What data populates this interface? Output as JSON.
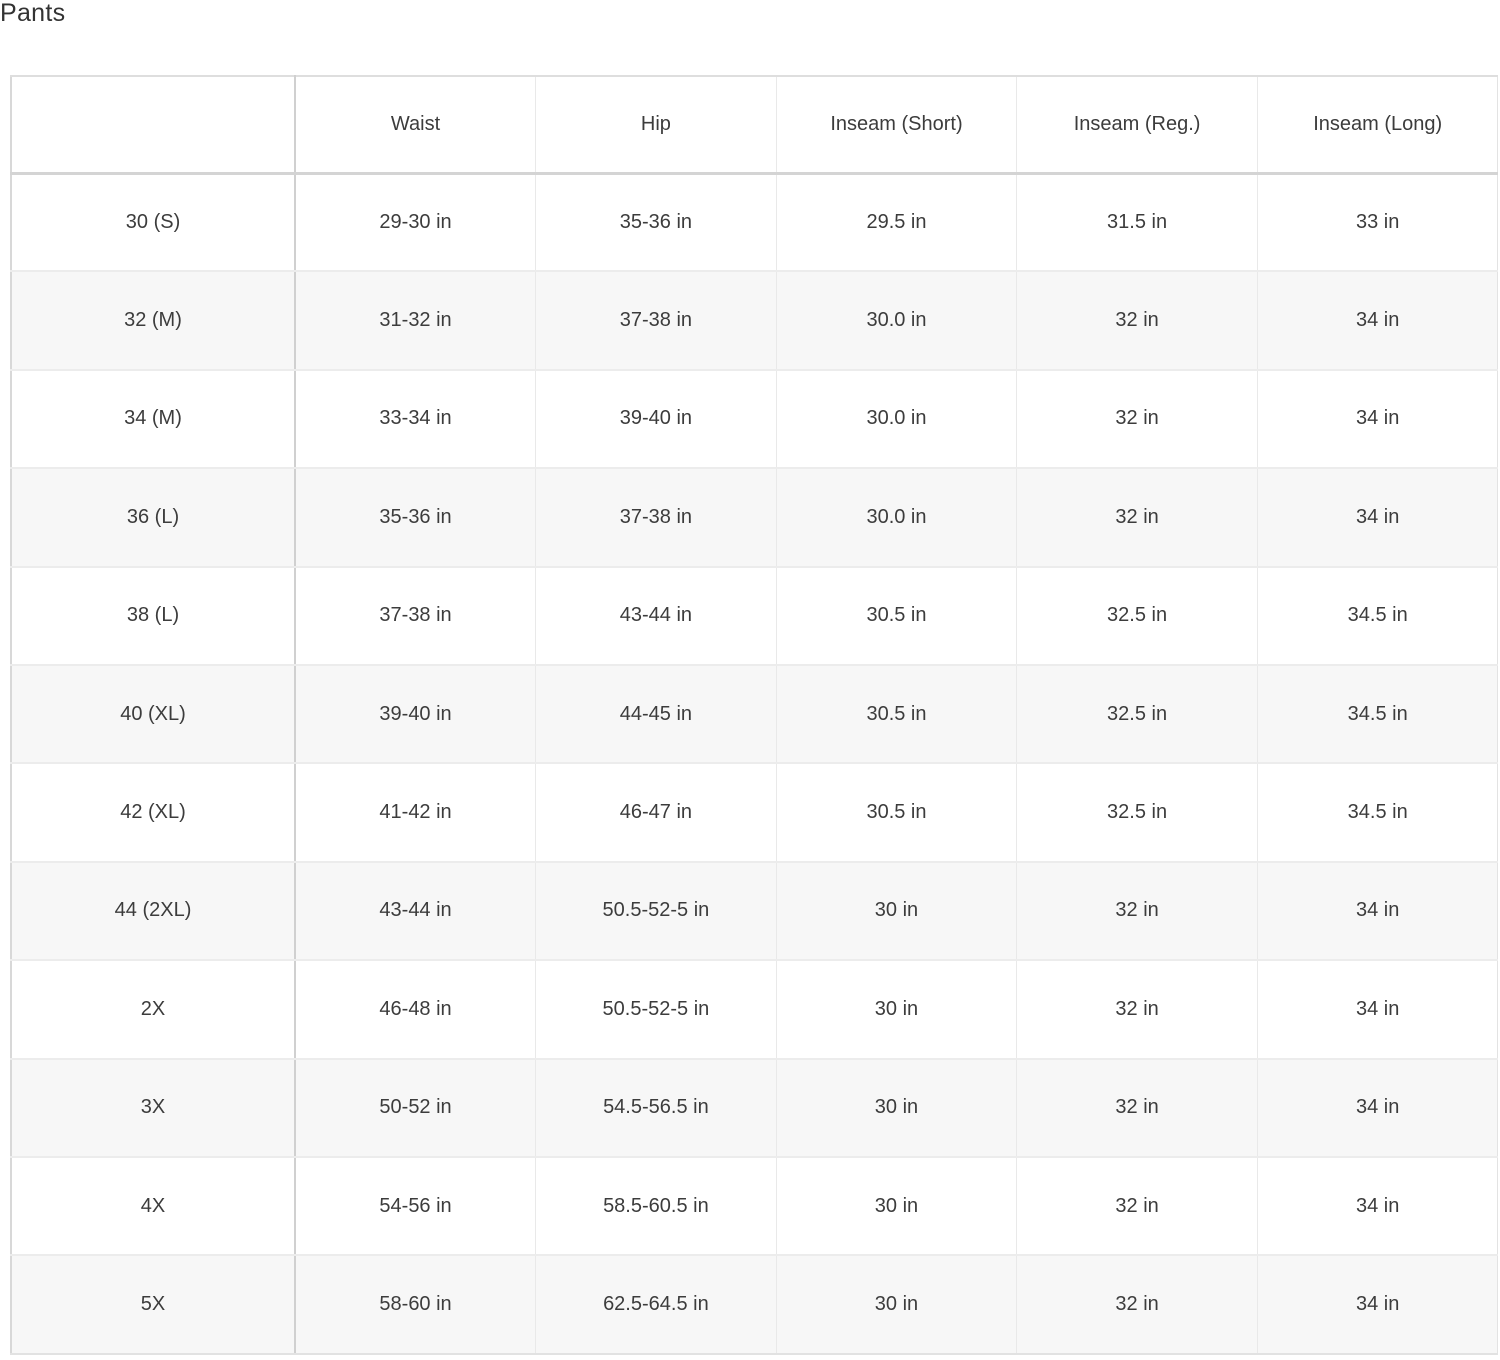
{
  "title": "Pants",
  "table": {
    "headers": [
      "",
      "Waist",
      "Hip",
      "Inseam (Short)",
      "Inseam (Reg.)",
      "Inseam (Long)"
    ],
    "rows": [
      [
        "30 (S)",
        "29-30 in",
        "35-36 in",
        "29.5 in",
        "31.5 in",
        "33 in"
      ],
      [
        "32 (M)",
        "31-32 in",
        "37-38 in",
        "30.0 in",
        "32 in",
        "34 in"
      ],
      [
        "34 (M)",
        "33-34 in",
        "39-40 in",
        "30.0 in",
        "32 in",
        "34 in"
      ],
      [
        "36 (L)",
        "35-36 in",
        "37-38 in",
        "30.0 in",
        "32 in",
        "34 in"
      ],
      [
        "38 (L)",
        "37-38 in",
        "43-44 in",
        "30.5 in",
        "32.5 in",
        "34.5 in"
      ],
      [
        "40 (XL)",
        "39-40 in",
        "44-45 in",
        "30.5 in",
        "32.5 in",
        "34.5 in"
      ],
      [
        "42 (XL)",
        "41-42 in",
        "46-47 in",
        "30.5 in",
        "32.5 in",
        "34.5 in"
      ],
      [
        "44 (2XL)",
        "43-44 in",
        "50.5-52-5 in",
        "30 in",
        "32 in",
        "34 in"
      ],
      [
        "2X",
        "46-48 in",
        "50.5-52-5 in",
        "30 in",
        "32 in",
        "34 in"
      ],
      [
        "3X",
        "50-52 in",
        "54.5-56.5 in",
        "30 in",
        "32 in",
        "34 in"
      ],
      [
        "4X",
        "54-56 in",
        "58.5-60.5 in",
        "30 in",
        "32 in",
        "34 in"
      ],
      [
        "5X",
        "58-60 in",
        "62.5-64.5 in",
        "30 in",
        "32 in",
        "34 in"
      ]
    ]
  }
}
